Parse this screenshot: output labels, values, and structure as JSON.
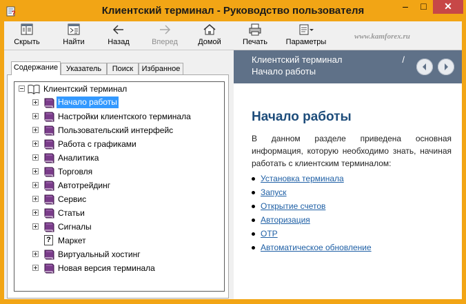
{
  "window": {
    "title": "Клиентский терминал - Руководство пользователя",
    "controls": {
      "minimize": "–",
      "maximize": "□",
      "close": "✕"
    }
  },
  "toolbar": {
    "buttons": [
      {
        "label": "Скрыть",
        "icon": "hide-pane-icon",
        "enabled": true
      },
      {
        "label": "Найти",
        "icon": "locate-icon",
        "enabled": true
      },
      {
        "label": "Назад",
        "icon": "back-arrow-icon",
        "enabled": true
      },
      {
        "label": "Вперед",
        "icon": "forward-arrow-icon",
        "enabled": false
      },
      {
        "label": "Домой",
        "icon": "home-icon",
        "enabled": true
      },
      {
        "label": "Печать",
        "icon": "printer-icon",
        "enabled": true
      },
      {
        "label": "Параметры",
        "icon": "options-icon",
        "enabled": true
      }
    ],
    "watermark": "www.kamforex.ru"
  },
  "nav_tabs": [
    {
      "label": "Содержание",
      "active": true
    },
    {
      "label": "Указатель",
      "active": false
    },
    {
      "label": "Поиск",
      "active": false
    },
    {
      "label": "Избранное",
      "active": false
    }
  ],
  "tree": {
    "root": "Клиентский терминал",
    "items": [
      {
        "label": "Начало работы",
        "type": "book",
        "selected": true
      },
      {
        "label": "Настройки клиентского терминала",
        "type": "book"
      },
      {
        "label": "Пользовательский интерфейс",
        "type": "book"
      },
      {
        "label": "Работа с графиками",
        "type": "book"
      },
      {
        "label": "Аналитика",
        "type": "book"
      },
      {
        "label": "Торговля",
        "type": "book"
      },
      {
        "label": "Автотрейдинг",
        "type": "book"
      },
      {
        "label": "Сервис",
        "type": "book"
      },
      {
        "label": "Статьи",
        "type": "book"
      },
      {
        "label": "Сигналы",
        "type": "book"
      },
      {
        "label": "Маркет",
        "type": "page"
      },
      {
        "label": "Виртуальный хостинг",
        "type": "book"
      },
      {
        "label": "Новая версия терминала",
        "type": "book"
      }
    ]
  },
  "content": {
    "header_part1": "Клиентский терминал",
    "header_sep": "/",
    "header_part2": "Начало работы",
    "heading": "Начало работы",
    "paragraph": "В данном разделе приведена основная информация, которую необходимо знать, начиная работать с клиентским терминалом:",
    "links": [
      "Установка терминала",
      "Запуск",
      "Открытие счетов",
      "Авторизация",
      "OTP",
      "Автоматическое обновление"
    ]
  },
  "colors": {
    "title_bar": "#f2a515",
    "header_band": "#5f7188",
    "heading_text": "#1e4d7b",
    "link": "#1e5fa5",
    "selection": "#3399ff",
    "close_button": "#c74747"
  }
}
